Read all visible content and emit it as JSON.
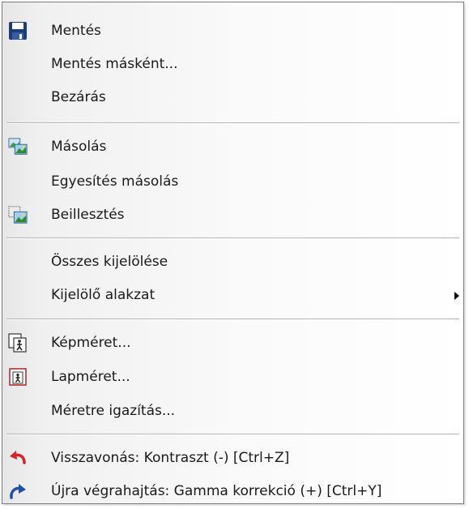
{
  "menu": {
    "save": {
      "label": "Mentés",
      "icon": "floppy-disk-icon"
    },
    "save_as": {
      "label": "Mentés másként..."
    },
    "close": {
      "label": "Bezárás"
    },
    "copy": {
      "label": "Másolás",
      "icon": "copy-image-icon"
    },
    "merge_copy": {
      "label": "Egyesítés másolás"
    },
    "paste": {
      "label": "Beillesztés",
      "icon": "paste-image-icon"
    },
    "select_all": {
      "label": "Összes kijelölése"
    },
    "selection_shape": {
      "label": "Kijelölő alakzat",
      "icon": "submenu-arrow-icon"
    },
    "image_size": {
      "label": "Képméret...",
      "icon": "image-size-icon"
    },
    "canvas_size": {
      "label": "Lapméret...",
      "icon": "canvas-size-icon"
    },
    "fit_to_size": {
      "label": "Méretre igazítás..."
    },
    "undo": {
      "label": "Visszavonás:  Kontraszt (-) [Ctrl+Z]",
      "icon": "undo-icon"
    },
    "redo": {
      "label": "Újra végrahajtás:  Gamma korrekció (+) [Ctrl+Y]",
      "icon": "redo-icon"
    }
  },
  "colors": {
    "undo_red": "#d0232a",
    "redo_blue": "#1f4fa8",
    "floppy_blue": "#1d3d7a"
  }
}
